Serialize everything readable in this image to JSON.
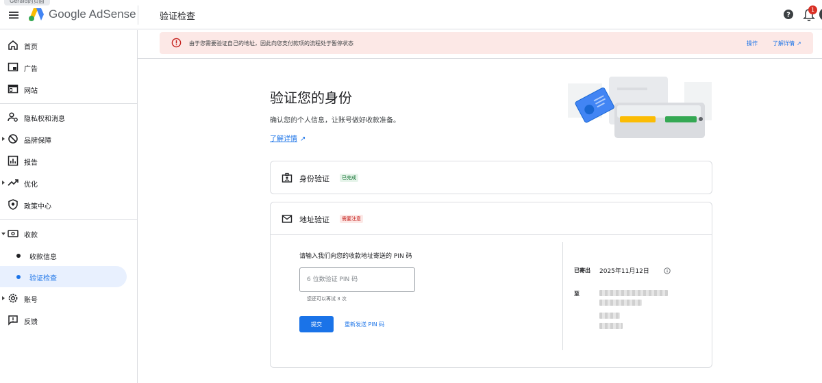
{
  "header": {
    "tooltip": "Gerald的页面",
    "brand_name": "Google AdSense",
    "page_title": "验证检查",
    "notification_count": "1"
  },
  "sidebar": {
    "items": [
      {
        "label": "首页",
        "icon": "home-icon"
      },
      {
        "label": "广告",
        "icon": "ads-icon"
      },
      {
        "label": "网站",
        "icon": "sites-icon"
      },
      {
        "label": "隐私权和消息",
        "icon": "privacy-icon"
      },
      {
        "label": "品牌保障",
        "icon": "brand-safety-icon"
      },
      {
        "label": "报告",
        "icon": "reports-icon"
      },
      {
        "label": "优化",
        "icon": "optimization-icon"
      },
      {
        "label": "政策中心",
        "icon": "policy-icon"
      },
      {
        "label": "收款",
        "icon": "payments-icon"
      },
      {
        "label": "收款信息",
        "icon": "dot"
      },
      {
        "label": "验证检查",
        "icon": "dot",
        "active": true
      },
      {
        "label": "账号",
        "icon": "account-icon"
      },
      {
        "label": "反馈",
        "icon": "feedback-icon"
      }
    ]
  },
  "alert": {
    "text": "由于您需要验证自己的地址，因此向您支付款项的流程处于暂停状态",
    "action_label": "操作",
    "learn_more_label": "了解详情",
    "color": "#fce8e6"
  },
  "main": {
    "heading": "验证您的身份",
    "subtitle": "确认您的个人信息，让账号做好收款准备。",
    "learn_more": "了解详情"
  },
  "identity_card": {
    "title": "身份验证",
    "status": "已完成"
  },
  "address_card": {
    "title": "地址验证",
    "status": "需要注意",
    "pin_prompt": "请输入我们向您的收款地址寄送的 PIN 码",
    "pin_placeholder": "6 位数验证 PIN 码",
    "retry_text": "您还可以再试 3 次",
    "submit_label": "提交",
    "resend_label": "重新发送 PIN 码",
    "sent_label": "已寄出",
    "sent_date": "2025年11月12日",
    "to_label": "至"
  },
  "colors": {
    "accent": "#1a73e8",
    "success_bg": "#e6f4ea",
    "warning_bg": "#fce8e6"
  }
}
